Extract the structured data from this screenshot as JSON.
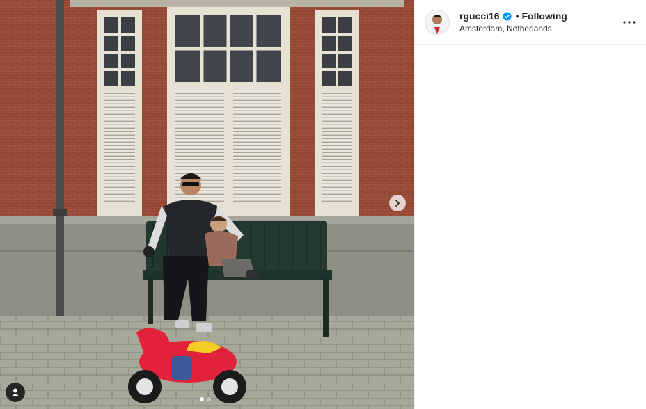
{
  "post": {
    "author": {
      "username": "rgucci16",
      "verified": true,
      "follow_state": "Following",
      "separator": "•",
      "location": "Amsterdam, Netherlands"
    },
    "media": {
      "carousel_count": 2,
      "carousel_index": 0
    },
    "icons": {
      "verified": "verified-badge-icon",
      "more": "more-options-icon",
      "next": "chevron-right-icon",
      "user_tag": "user-tag-icon"
    },
    "colors": {
      "verified": "#0095f6",
      "text": "#262626",
      "divider": "#efefef"
    }
  }
}
